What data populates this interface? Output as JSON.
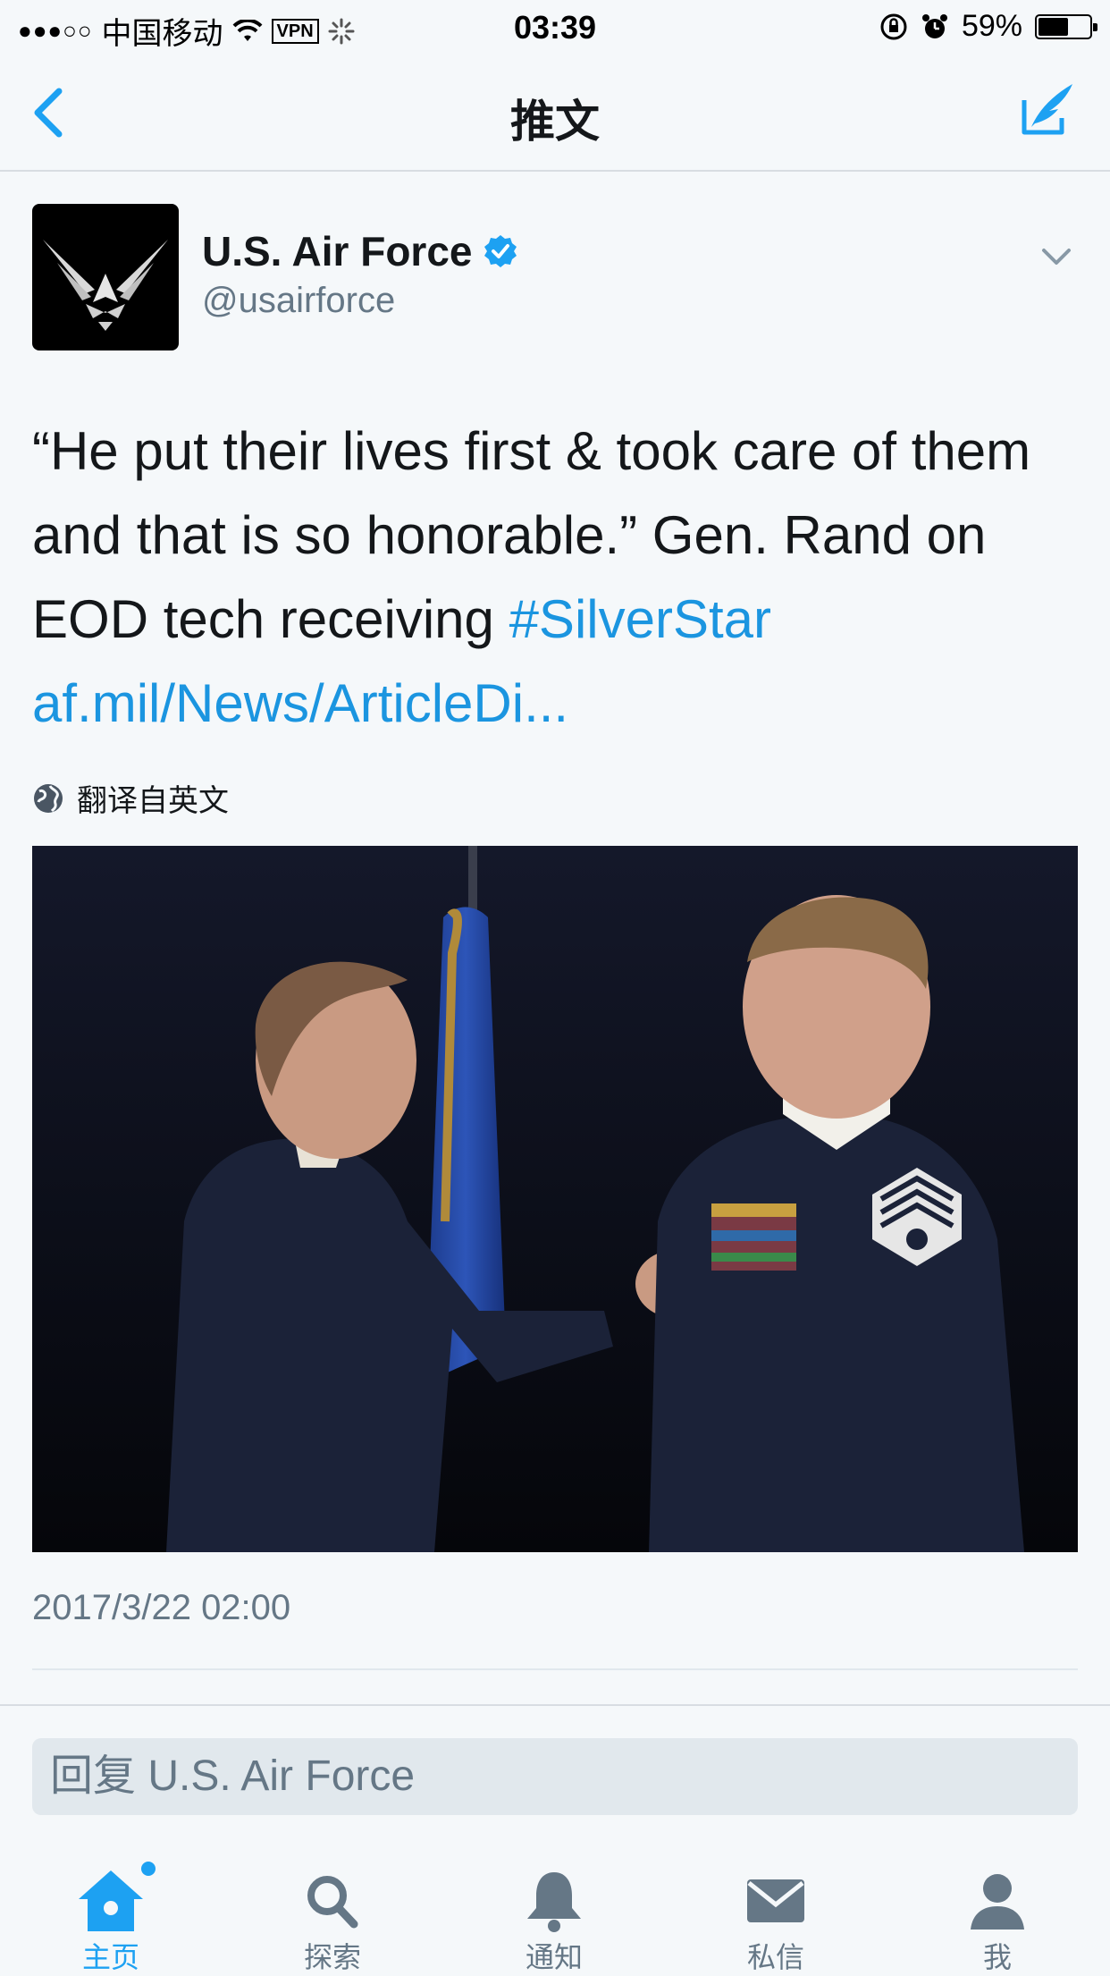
{
  "status_bar": {
    "signal": "●●●○○",
    "carrier": "中国移动",
    "vpn": "VPN",
    "time": "03:39",
    "battery_percent": "59%",
    "battery_level": 0.59
  },
  "nav": {
    "title": "推文",
    "back_icon": "chevron-left-icon",
    "compose_icon": "compose-icon"
  },
  "tweet": {
    "author_name": "U.S. Air Force",
    "author_handle": "@usairforce",
    "verified": true,
    "text_plain": "“He put their lives first & took care of them and that is so honorable.” Gen. Rand on EOD tech receiving ",
    "hashtag": "#SilverStar",
    "link": "af.mil/News/ArticleDi...",
    "translate_label": "翻译自英文",
    "timestamp": "2017/3/22 02:00"
  },
  "reply": {
    "placeholder": "回复 U.S. Air Force"
  },
  "tabbar": {
    "items": [
      {
        "label": "主页",
        "icon": "home-icon",
        "active": true
      },
      {
        "label": "探索",
        "icon": "search-icon",
        "active": false
      },
      {
        "label": "通知",
        "icon": "bell-icon",
        "active": false
      },
      {
        "label": "私信",
        "icon": "envelope-icon",
        "active": false
      },
      {
        "label": "我",
        "icon": "person-icon",
        "active": false
      }
    ]
  },
  "colors": {
    "accent": "#1da1f2",
    "link": "#1b95e0",
    "secondary_text": "#657786",
    "background": "#f5f8fa"
  }
}
